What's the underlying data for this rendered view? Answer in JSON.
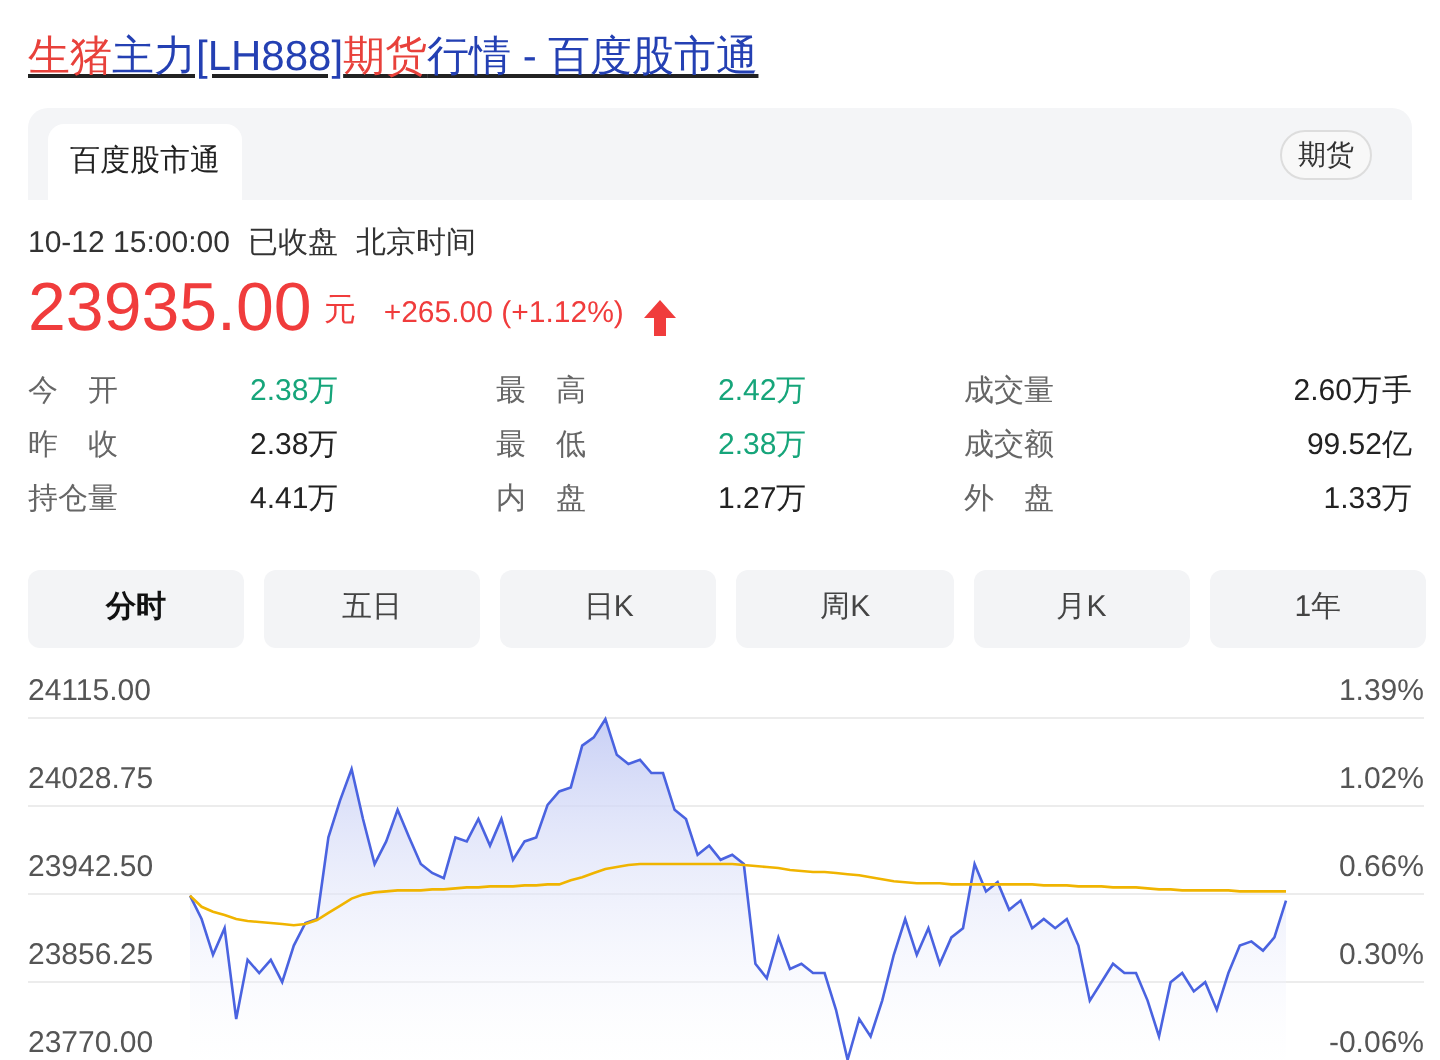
{
  "title": {
    "segments": [
      {
        "text": "生猪",
        "highlight": true
      },
      {
        "text": "主力[LH888]",
        "highlight": false
      },
      {
        "text": "期货",
        "highlight": true
      },
      {
        "text": "行情 - 百度股市通",
        "highlight": false
      }
    ]
  },
  "source_tab": {
    "label": "百度股市通"
  },
  "badge": "期货",
  "quote": {
    "time": "10-12 15:00:00",
    "status": "已收盘",
    "timezone": "北京时间",
    "price": "23935.00",
    "unit": "元",
    "change": "+265.00 (+1.12%)",
    "rising": true
  },
  "stats": [
    {
      "label": "今　开",
      "value": "2.38万",
      "color": "#16a57a"
    },
    {
      "label": "最　高",
      "value": "2.42万",
      "color": "#16a57a"
    },
    {
      "label": "成交量",
      "value": "2.60万手",
      "color": "#222222"
    },
    {
      "label": "昨　收",
      "value": "2.38万",
      "color": "#222222"
    },
    {
      "label": "最　低",
      "value": "2.38万",
      "color": "#16a57a"
    },
    {
      "label": "成交额",
      "value": "99.52亿",
      "color": "#222222"
    },
    {
      "label": "持仓量",
      "value": "4.41万",
      "color": "#222222"
    },
    {
      "label": "内　盘",
      "value": "1.27万",
      "color": "#222222"
    },
    {
      "label": "外　盘",
      "value": "1.33万",
      "color": "#222222"
    }
  ],
  "period_tabs": [
    {
      "label": "分时",
      "selected": true
    },
    {
      "label": "五日",
      "selected": false
    },
    {
      "label": "日K",
      "selected": false
    },
    {
      "label": "周K",
      "selected": false
    },
    {
      "label": "月K",
      "selected": false
    },
    {
      "label": "1年",
      "selected": false
    }
  ],
  "right_axis_labels": [
    "1.39%",
    "1.02%",
    "0.66%",
    "0.30%",
    "-0.06%"
  ],
  "chart_data": {
    "type": "line",
    "grid": true,
    "ylim": [
      23770,
      24115
    ],
    "yticks": [
      {
        "value": 24115,
        "label": "24115.00"
      },
      {
        "value": 24028.75,
        "label": "24028.75"
      },
      {
        "value": 23942.5,
        "label": "23942.50"
      },
      {
        "value": 23856.25,
        "label": "23856.25"
      },
      {
        "value": 23770,
        "label": "23770.00"
      }
    ],
    "series": [
      {
        "type": "area",
        "color": "#4a63e0",
        "values": [
          23941,
          23918,
          23883,
          23909,
          23820,
          23878,
          23865,
          23878,
          23856,
          23892,
          23914,
          23918,
          23998,
          24034,
          24065,
          24016,
          23972,
          23994,
          24025,
          23998,
          23972,
          23963,
          23958,
          23998,
          23994,
          24016,
          23990,
          24016,
          23976,
          23994,
          23998,
          24030,
          24043,
          24047,
          24088,
          24096,
          24114,
          24079,
          24070,
          24074,
          24061,
          24061,
          24025,
          24016,
          23981,
          23990,
          23976,
          23981,
          23972,
          23874,
          23860,
          23900,
          23869,
          23874,
          23865,
          23865,
          23829,
          23780,
          23820,
          23803,
          23838,
          23883,
          23918,
          23883,
          23909,
          23874,
          23900,
          23909,
          23972,
          23945,
          23954,
          23927,
          23936,
          23909,
          23918,
          23909,
          23918,
          23892,
          23838,
          23856,
          23874,
          23865,
          23865,
          23838,
          23803,
          23856,
          23865,
          23847,
          23856,
          23829,
          23865,
          23892,
          23896,
          23887,
          23900,
          23936
        ]
      },
      {
        "type": "line",
        "color": "#f0b400",
        "values": [
          23941,
          23930,
          23925,
          23922,
          23918,
          23916,
          23915,
          23914,
          23913,
          23912,
          23913,
          23917,
          23924,
          23931,
          23938,
          23942,
          23944,
          23945,
          23946,
          23946,
          23946,
          23947,
          23947,
          23948,
          23949,
          23949,
          23950,
          23950,
          23950,
          23951,
          23951,
          23952,
          23952,
          23956,
          23959,
          23963,
          23967,
          23969,
          23971,
          23972,
          23972,
          23972,
          23972,
          23972,
          23972,
          23972,
          23972,
          23972,
          23971,
          23970,
          23969,
          23968,
          23966,
          23965,
          23964,
          23964,
          23963,
          23962,
          23961,
          23959,
          23957,
          23955,
          23954,
          23953,
          23953,
          23953,
          23952,
          23952,
          23952,
          23952,
          23952,
          23952,
          23952,
          23952,
          23951,
          23951,
          23951,
          23950,
          23950,
          23950,
          23949,
          23949,
          23949,
          23948,
          23947,
          23947,
          23946,
          23946,
          23946,
          23946,
          23946,
          23945,
          23945,
          23945,
          23945,
          23945
        ]
      }
    ]
  }
}
